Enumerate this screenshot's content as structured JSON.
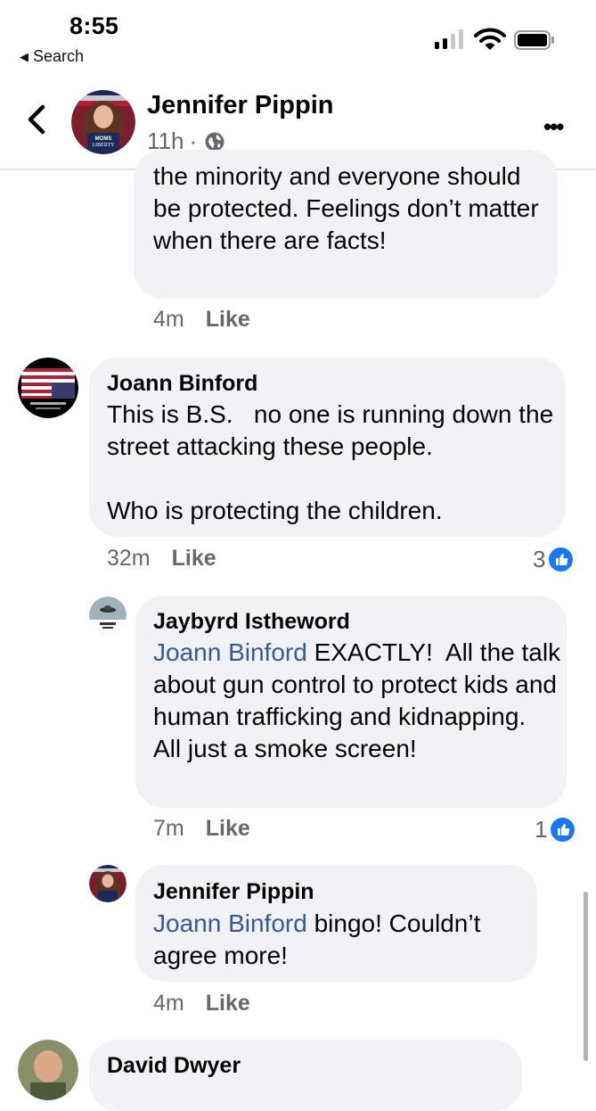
{
  "status_bar": {
    "time": "8:55",
    "back_app_label": "Search",
    "icons": [
      "cellular-signal-icon",
      "wifi-icon",
      "battery-icon"
    ]
  },
  "header": {
    "name": "Jennifer Pippin",
    "timestamp": "11h",
    "separator": "·",
    "audience_icon": "globe-icon",
    "back_icon": "chevron-left-icon",
    "more_icon": "more-dots-icon",
    "more_label": "•••"
  },
  "comments": [
    {
      "text": "the minority and everyone should be protected. Feelings don’t matter when there are facts!",
      "time": "4m",
      "like_label": "Like"
    },
    {
      "name": "Joann Binford",
      "text": "This is B.S.   no one is running down the street attacking these people.\n\nWho is protecting the children.",
      "time": "32m",
      "like_label": "Like",
      "reactions": "3"
    },
    {
      "name": "Jaybyrd Istheword",
      "mention": "Joann Binford",
      "text": " EXACTLY!  All the talk about gun control to protect kids and human trafficking and kidnapping.  All just a smoke screen!",
      "time": "7m",
      "like_label": "Like",
      "reactions": "1"
    },
    {
      "name": "Jennifer Pippin",
      "mention": "Joann Binford",
      "text": " bingo! Couldn’t agree more!",
      "time": "4m",
      "like_label": "Like"
    },
    {
      "name": "David Dwyer"
    }
  ],
  "colors": {
    "bubble": "#f0f2f5",
    "meta_text": "#65676b",
    "mention": "#385898",
    "like_blue": "#1877f2"
  }
}
